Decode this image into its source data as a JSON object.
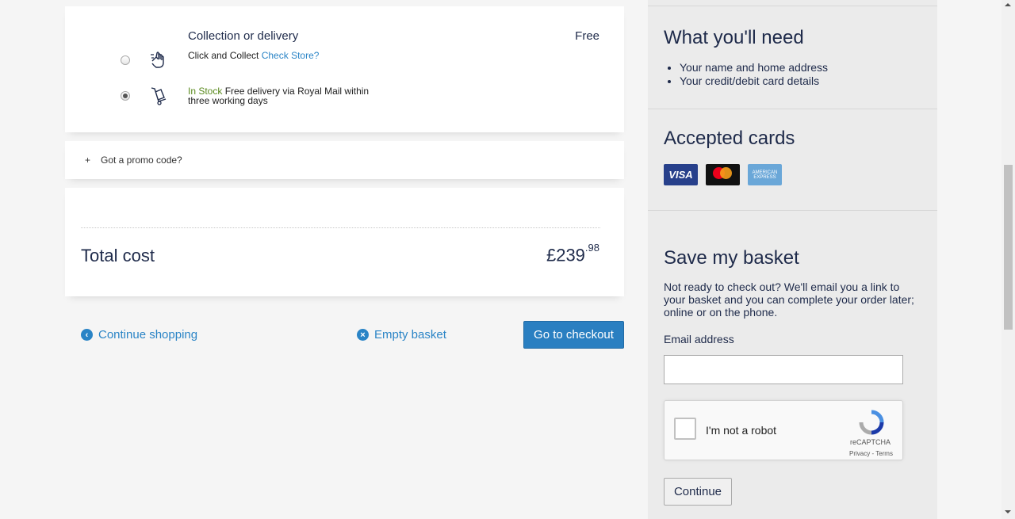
{
  "delivery": {
    "title": "Collection or delivery",
    "price": "Free",
    "options": [
      {
        "text": "Click and Collect",
        "link": "Check Store?",
        "selected": false
      },
      {
        "status": "In Stock",
        "text_line1": "Free delivery via Royal Mail within",
        "text_line2": "three working days",
        "selected": true
      }
    ]
  },
  "promo": {
    "icon": "+",
    "label": "Got a promo code?"
  },
  "total": {
    "label": "Total cost",
    "price_main": "£239",
    "price_pence": ".98"
  },
  "actions": {
    "continue_shopping": "Continue shopping",
    "empty_basket": "Empty basket",
    "checkout": "Go to checkout"
  },
  "sidebar": {
    "need_title": "What you'll need",
    "need_items": [
      "Your name and home address",
      "Your credit/debit card details"
    ],
    "cards_title": "Accepted cards",
    "cards": [
      "VISA",
      "mastercard",
      "AMERICAN EXPRESS"
    ],
    "save_title": "Save my basket",
    "save_text": "Not ready to check out? We'll email you a link to your basket and you can complete your order later; online or on the phone.",
    "email_label": "Email address",
    "email_value": "",
    "captcha_text": "I'm not a robot",
    "captcha_brand": "reCAPTCHA",
    "captcha_links": "Privacy - Terms",
    "continue_label": "Continue"
  },
  "colors": {
    "accent": "#2a84c6",
    "heading": "#1e2a4a",
    "stock": "#5a8a1e"
  }
}
